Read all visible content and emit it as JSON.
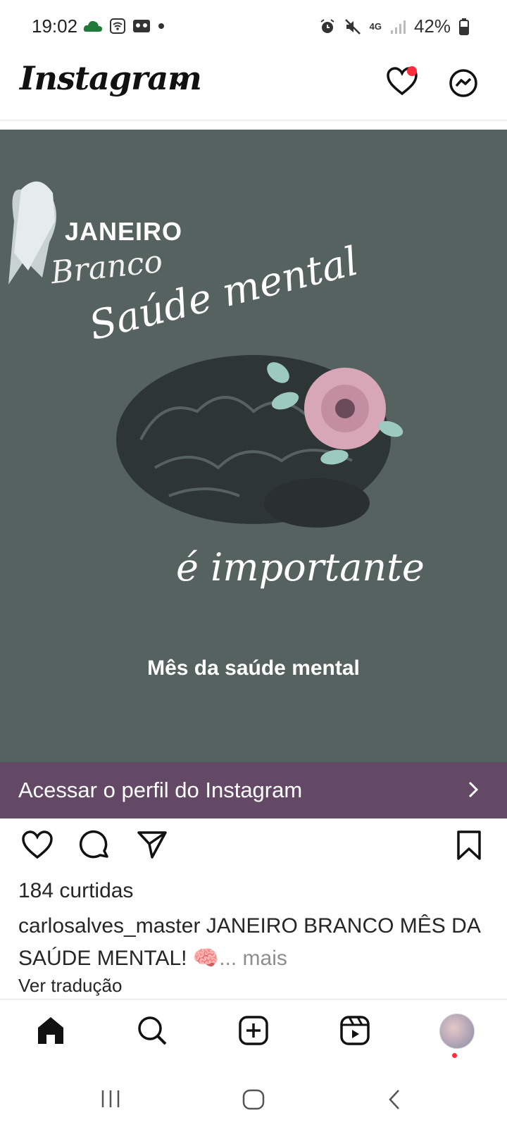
{
  "status_bar": {
    "time": "19:02",
    "network": "4G",
    "battery": "42%"
  },
  "header": {
    "app_name": "Instagram",
    "notification_color": "#ff2d3b"
  },
  "post": {
    "background_color": "#56625f",
    "image_text": {
      "line1": "JANEIRO",
      "line2": "Branco",
      "line3": "Saúde mental",
      "line4": "é importante",
      "line5": "Mês da saúde mental"
    }
  },
  "cta": {
    "label": "Acessar o perfil do Instagram",
    "color": "#634965"
  },
  "post_info": {
    "likes": "184 curtidas",
    "username": "carlosalves_master",
    "caption": " JANEIRO BRANCO MÊS DA SAÚDE MENTAL! 🧠",
    "more": "... mais",
    "translate": "Ver tradução"
  },
  "icons": {
    "bottom_nav": [
      "home-icon",
      "search-icon",
      "create-icon",
      "reels-icon",
      "profile-avatar"
    ],
    "actions": [
      "like-icon",
      "comment-icon",
      "share-icon",
      "save-icon"
    ]
  }
}
